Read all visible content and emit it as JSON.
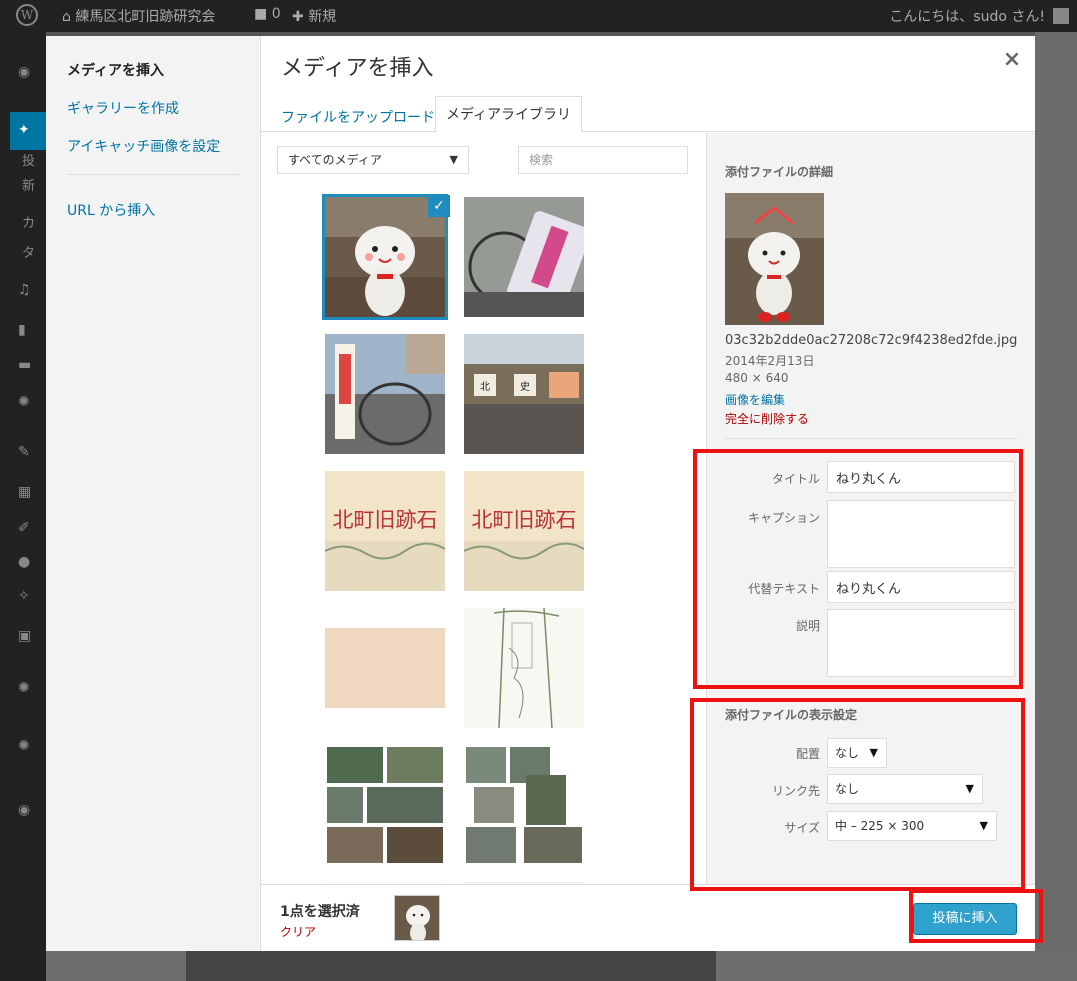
{
  "adminbar": {
    "site_name": "練馬区北町旧跡研究会",
    "comments_count": "0",
    "new_label": "新規",
    "howdy": "こんにちは、sudo さん!"
  },
  "leftmenu": {
    "partial_labels": [
      "投",
      "新",
      "カ",
      "タ"
    ]
  },
  "modal": {
    "title": "メディアを挿入",
    "close_glyph": "×",
    "menu": {
      "insert_media": "メディアを挿入",
      "create_gallery": "ギャラリーを作成",
      "set_featured": "アイキャッチ画像を設定",
      "insert_from_url": "URL から挿入"
    },
    "tabs": {
      "upload": "ファイルをアップロード",
      "library": "メディアライブラリ"
    },
    "filter": {
      "selected": "すべてのメディア",
      "arrow": "▼"
    },
    "search_placeholder": "検索",
    "check_glyph": "✓",
    "sidebar": {
      "details_heading": "添付ファイルの詳細",
      "filename": "03c32b2dde0ac27208c72c9f4238ed2fde.jpg",
      "date": "2014年2月13日",
      "dimensions": "480 × 640",
      "edit_image": "画像を編集",
      "delete_permanently": "完全に削除する",
      "fields": {
        "title_label": "タイトル",
        "title_value": "ねり丸くん",
        "caption_label": "キャプション",
        "caption_value": "",
        "alt_label": "代替テキスト",
        "alt_value": "ねり丸くん",
        "description_label": "説明",
        "description_value": ""
      },
      "display_heading": "添付ファイルの表示設定",
      "display": {
        "align_label": "配置",
        "align_value": "なし",
        "link_label": "リンク先",
        "link_value": "なし",
        "size_label": "サイズ",
        "size_value": "中 – 225 × 300",
        "arrow": "▼"
      }
    },
    "toolbar": {
      "selected_count": "1点を選択済",
      "clear": "クリア",
      "insert_button": "投稿に挿入"
    },
    "thumb_texts": {
      "sign1": "北町旧跡石",
      "sign2": "北町旧跡石",
      "sign_small": "北町 史跡"
    }
  },
  "colors": {
    "accent": "#0074a2",
    "button": "#2ea2cc",
    "highlight": "#e11111",
    "delete": "#aa0000"
  }
}
